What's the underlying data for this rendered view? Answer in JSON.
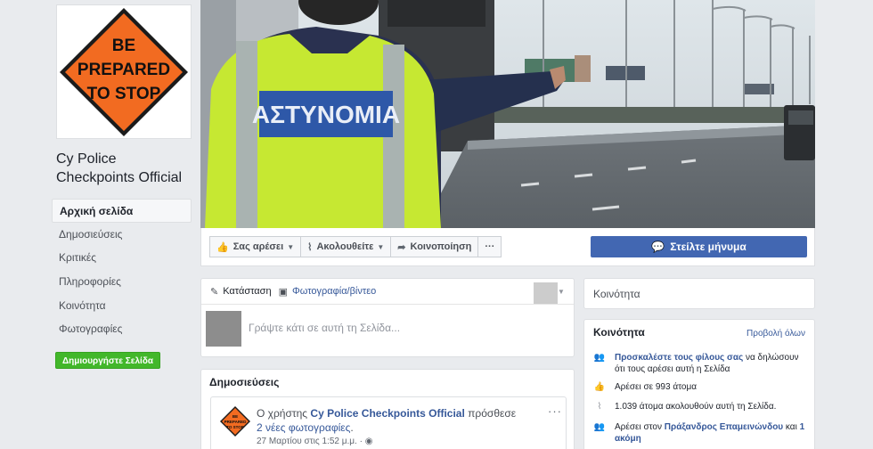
{
  "page": {
    "name_line1": "Cy Police",
    "name_line2": "Checkpoints Official",
    "sign_lines": [
      "BE",
      "PREPARED",
      "TO STOP"
    ],
    "cover_vest_text": "ΑΣΤΥΝΟΜΙΑ"
  },
  "sidebar": {
    "items": [
      {
        "label": "Αρχική σελίδα"
      },
      {
        "label": "Δημοσιεύσεις"
      },
      {
        "label": "Κριτικές"
      },
      {
        "label": "Πληροφορίες"
      },
      {
        "label": "Κοινότητα"
      },
      {
        "label": "Φωτογραφίες"
      }
    ],
    "create_page": "Δημιουργήστε Σελίδα"
  },
  "actions": {
    "like": "Σας αρέσει",
    "follow": "Ακολουθείτε",
    "share": "Κοινοποίηση",
    "more": "···",
    "message": "Στείλτε μήνυμα"
  },
  "composer": {
    "status": "Κατάσταση",
    "photo_video": "Φωτογραφία/βίντεο",
    "placeholder": "Γράψτε κάτι σε αυτή τη Σελίδα..."
  },
  "posts": {
    "title": "Δημοσιεύσεις",
    "post": {
      "prefix": "Ο χρήστης",
      "author": "Cy Police Checkpoints Official",
      "action": "πρόσθεσε",
      "photos_link": "2 νέες φωτογραφίες",
      "suffix": ".",
      "time": "27 Μαρτίου στις 1:52 μ.μ. ·",
      "more": "···"
    }
  },
  "community_header": "Κοινότητα",
  "community": {
    "title": "Κοινότητα",
    "see_all": "Προβολή όλων",
    "invite_link": "Προσκαλέστε τους φίλους σας",
    "invite_rest": " να δηλώσουν ότι τους αρέσει αυτή η Σελίδα",
    "likes": "Αρέσει σε 993 άτομα",
    "follows": "1.039 άτομα ακολουθούν αυτή τη Σελίδα.",
    "liked_by_prefix": "Αρέσει στον ",
    "liked_by_name": "Πράξανδρος Επαμεινώνδου",
    "liked_by_mid": " και ",
    "liked_by_more": "1 ακόμη"
  },
  "colors": {
    "brand_blue": "#4267b2",
    "link_blue": "#365899",
    "green": "#42b72a",
    "sign_orange": "#f26b21",
    "vest_yellow": "#c6e832"
  }
}
